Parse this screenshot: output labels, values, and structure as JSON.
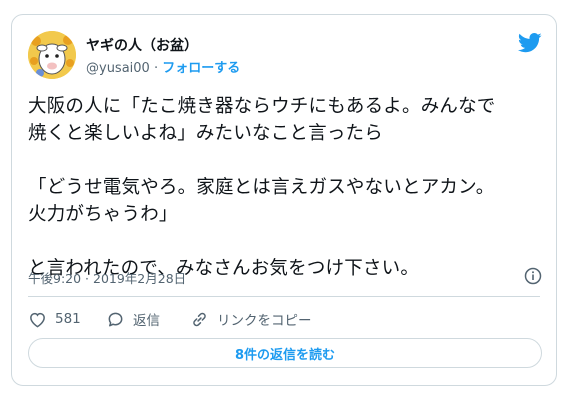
{
  "user": {
    "display_name": "ヤギの人（お盆）",
    "handle": "@yusai00",
    "separator": "·",
    "follow_label": "フォローする"
  },
  "tweet": {
    "text": "大阪の人に「たこ焼き器ならウチにもあるよ。みんなで\n焼くと楽しいよね」みたいなこと言ったら\n\n「どうせ電気やろ。家庭とは言えガスやないとアカン。\n火力がちゃうわ」\n\nと言われたので、みなさんお気をつけ下さい。",
    "timestamp": "午後9:20 · 2019年2月28日"
  },
  "actions": {
    "like_count": "581",
    "reply_label": "返信",
    "copy_link_label": "リンクをコピー"
  },
  "replies_button_label": "8件の返信を読む",
  "colors": {
    "accent": "#1d9bf0",
    "text": "#0f1419",
    "muted": "#536471",
    "border": "#cfd9de"
  },
  "icons": {
    "brand": "twitter-bird-icon",
    "info": "info-icon",
    "like": "heart-icon",
    "reply": "speech-bubble-icon",
    "copy_link": "link-icon"
  }
}
